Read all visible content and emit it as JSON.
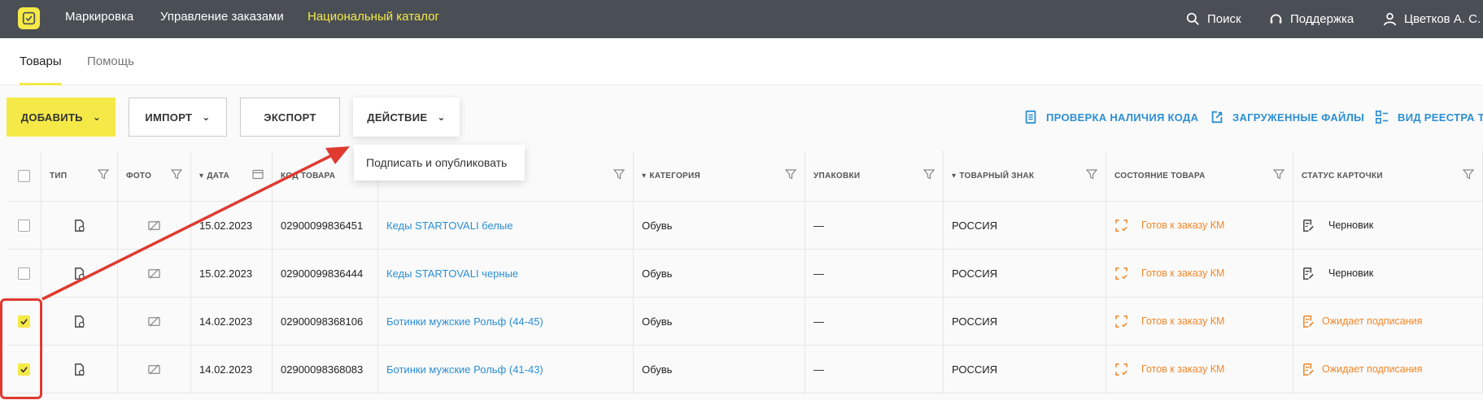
{
  "topbar": {
    "nav": [
      "Маркировка",
      "Управление заказами",
      "Национальный каталог"
    ],
    "search": "Поиск",
    "support": "Поддержка",
    "user": "Цветков А. С."
  },
  "subnav": {
    "tabs": [
      "Товары",
      "Помощь"
    ]
  },
  "toolbar": {
    "add": "ДОБАВИТЬ",
    "import": "ИМПОРТ",
    "export": "ЭКСПОРТ",
    "action": "ДЕЙСТВИЕ",
    "check_code": "ПРОВЕРКА НАЛИЧИЯ КОДА",
    "uploaded_files": "ЗАГРУЖЕННЫЕ ФАЙЛЫ",
    "registry_view": "ВИД РЕЕСТРА ТОВАРОВ"
  },
  "dropdown": {
    "item": "Подписать и опубликовать"
  },
  "table": {
    "headers": [
      "ТИП",
      "ФОТО",
      "ДАТА",
      "КОД ТОВАРА",
      "",
      "КАТЕГОРИЯ",
      "УПАКОВКИ",
      "ТОВАРНЫЙ ЗНАК",
      "СОСТОЯНИЕ ТОВАРА",
      "СТАТУС КАРТОЧКИ"
    ],
    "rows": [
      {
        "checked": false,
        "date": "15.02.2023",
        "code": "02900099836451",
        "name": "Кеды STARTOVALI белые",
        "category": "Обувь",
        "packages": "—",
        "brand": "РОССИЯ",
        "state": "Готов к заказу КМ",
        "status": "Черновик",
        "status_orange": false
      },
      {
        "checked": false,
        "date": "15.02.2023",
        "code": "02900099836444",
        "name": "Кеды STARTOVALI черные",
        "category": "Обувь",
        "packages": "—",
        "brand": "РОССИЯ",
        "state": "Готов к заказу КМ",
        "status": "Черновик",
        "status_orange": false
      },
      {
        "checked": true,
        "date": "14.02.2023",
        "code": "02900098368106",
        "name": "Ботинки мужские Рольф (44-45)",
        "category": "Обувь",
        "packages": "—",
        "brand": "РОССИЯ",
        "state": "Готов к заказу КМ",
        "status": "Ожидает подписания",
        "status_orange": true
      },
      {
        "checked": true,
        "date": "14.02.2023",
        "code": "02900098368083",
        "name": "Ботинки мужские Рольф (41-43)",
        "category": "Обувь",
        "packages": "—",
        "brand": "РОССИЯ",
        "state": "Готов к заказу КМ",
        "status": "Ожидает подписания",
        "status_orange": true
      }
    ]
  },
  "colors": {
    "accent": "#f5e947",
    "link": "#2c8fd4",
    "orange": "#f0862a",
    "annotation": "#e03a30",
    "topbar": "#4a4f55"
  }
}
